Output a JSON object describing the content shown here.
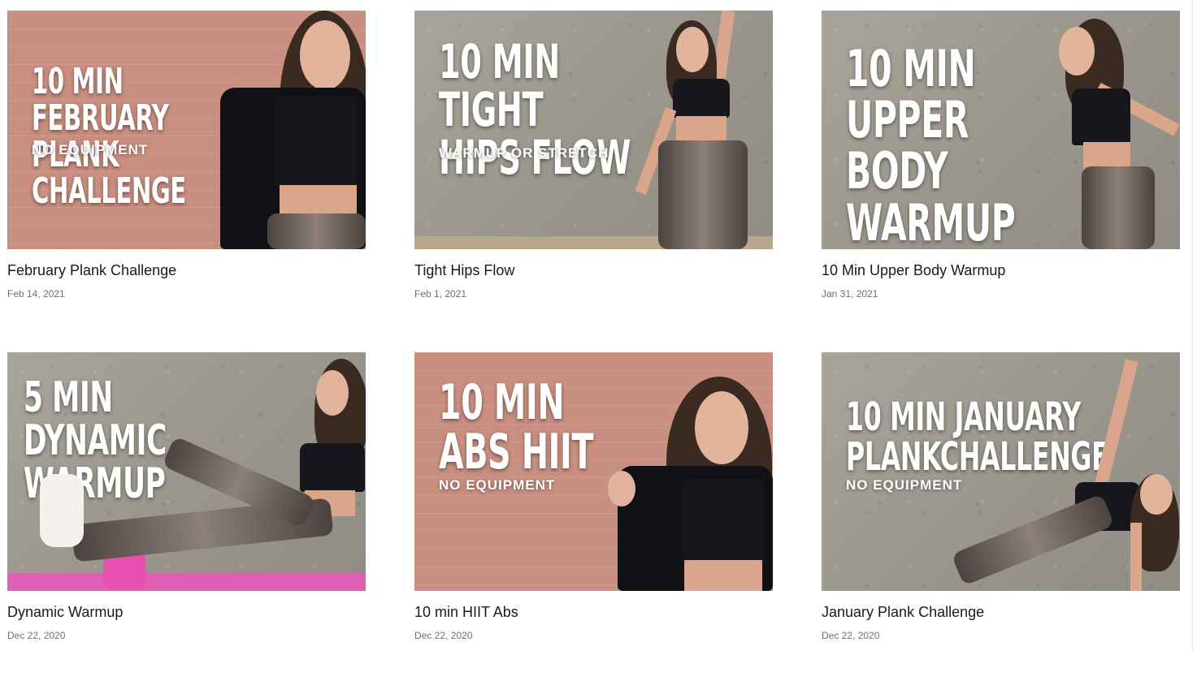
{
  "posts": [
    {
      "title": "February Plank Challenge",
      "date": "Feb 14, 2021",
      "thumb_headline": "10 MIN FEBRUARY\nPLANK CHALLENGE",
      "thumb_subline": "NO EQUIPMENT",
      "thumb_background": "brick",
      "thumb_colors": {
        "wall": "#c98f80"
      }
    },
    {
      "title": "Tight Hips Flow",
      "date": "Feb 1, 2021",
      "thumb_headline": "10 MIN TIGHT\nHIPS FLOW",
      "thumb_subline": "WARMUP OR STRETCH",
      "thumb_background": "concrete",
      "thumb_colors": {
        "wall": "#a9a59b"
      }
    },
    {
      "title": "10 Min Upper Body Warmup",
      "date": "Jan 31, 2021",
      "thumb_headline": "10 MIN\nUPPER BODY\nWARMUP",
      "thumb_subline": "",
      "thumb_background": "concrete",
      "thumb_colors": {
        "wall": "#a9a59b"
      }
    },
    {
      "title": "Dynamic Warmup",
      "date": "Dec 22, 2020",
      "thumb_headline": "5 MIN DYNAMIC\nWARMUP",
      "thumb_subline": "",
      "thumb_background": "concrete",
      "thumb_colors": {
        "wall": "#a9a59b"
      }
    },
    {
      "title": "10 min HIIT Abs",
      "date": "Dec 22, 2020",
      "thumb_headline": "10 MIN\nABS HIIT",
      "thumb_subline": "NO EQUIPMENT",
      "thumb_background": "brick",
      "thumb_colors": {
        "wall": "#c98f80"
      }
    },
    {
      "title": "January Plank Challenge",
      "date": "Dec 22, 2020",
      "thumb_headline": "10 MIN JANUARY\nPLANKCHALLENGE",
      "thumb_subline": "NO EQUIPMENT",
      "thumb_background": "concrete",
      "thumb_colors": {
        "wall": "#a9a59b"
      }
    }
  ]
}
